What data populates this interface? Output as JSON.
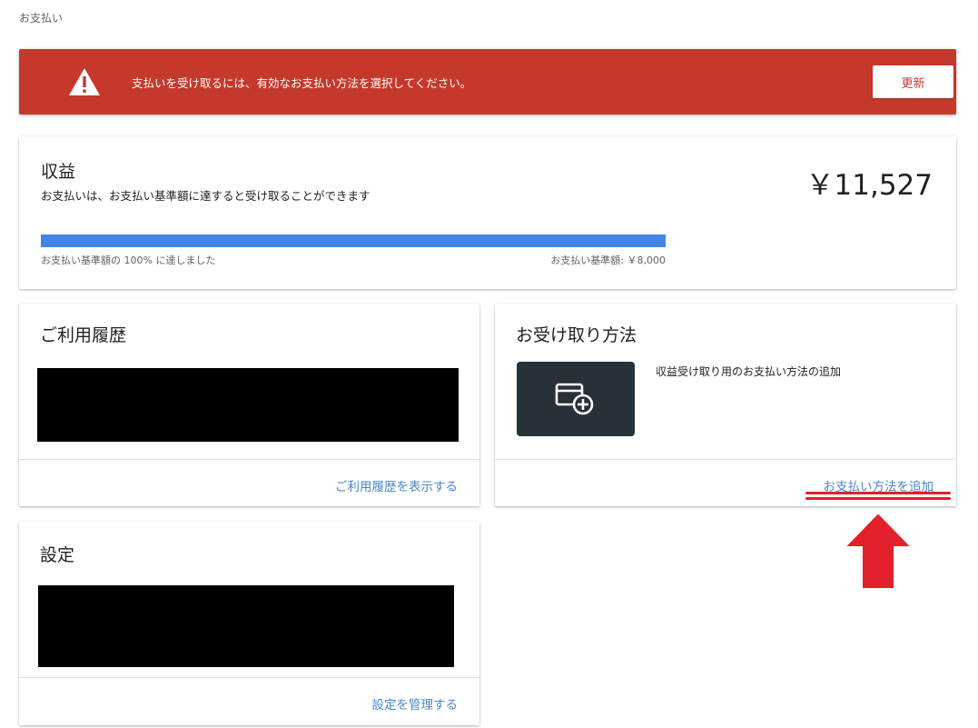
{
  "breadcrumb": "お支払い",
  "alert": {
    "message": "支払いを受け取るには、有効なお支払い方法を選択してください。",
    "button_label": "更新",
    "icon": "warning-icon"
  },
  "earnings": {
    "title": "収益",
    "subtitle": "お支払いは、お支払い基準額に達すると受け取ることができます",
    "amount": "￥11,527",
    "progress_fraction": 1.0,
    "progress_label": "お支払い基準額の 100% に達しました",
    "threshold_label": "お支払い基準額: ￥8,000"
  },
  "history": {
    "title": "ご利用履歴",
    "link_label": "ご利用履歴を表示する"
  },
  "payment_method": {
    "title": "お受け取り方法",
    "description": "収益受け取り用のお支払い方法の追加",
    "tile_icon": "add-card-icon",
    "link_label": "お支払い方法を追加"
  },
  "settings": {
    "title": "設定",
    "link_label": "設定を管理する"
  },
  "colors": {
    "alert_bg": "#c5392c",
    "progress": "#4285e4",
    "link": "#4a86c8",
    "annotation": "#e4202a",
    "tile_bg": "#263238"
  }
}
